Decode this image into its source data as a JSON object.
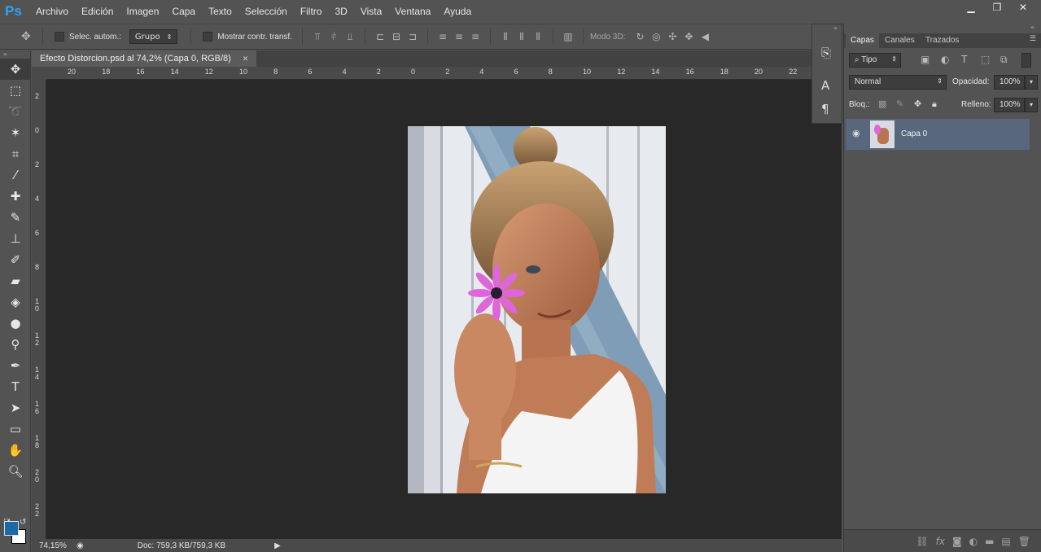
{
  "app": {
    "logo": "Ps"
  },
  "menu": [
    "Archivo",
    "Edición",
    "Imagen",
    "Capa",
    "Texto",
    "Selección",
    "Filtro",
    "3D",
    "Vista",
    "Ventana",
    "Ayuda"
  ],
  "window_controls": {
    "minimize": "▁",
    "restore": "❐",
    "close": "✕"
  },
  "options_bar": {
    "auto_select_label": "Selec. autom.:",
    "auto_select_value": "Grupo",
    "show_transform_label": "Mostrar contr. transf.",
    "mode_3d_label": "Modo 3D:"
  },
  "document": {
    "tab_title": "Efecto Distorcion.psd al 74,2% (Capa 0, RGB/8)",
    "close_glyph": "✕"
  },
  "rulers": {
    "horizontal": [
      "20",
      "18",
      "16",
      "14",
      "12",
      "10",
      "8",
      "6",
      "4",
      "2",
      "0",
      "2",
      "4",
      "6",
      "8",
      "10",
      "12",
      "14",
      "16",
      "18",
      "20",
      "22"
    ],
    "vertical": [
      "2",
      "0",
      "2",
      "4",
      "6",
      "8",
      "1 0",
      "1 2",
      "1 4",
      "1 6",
      "1 8",
      "2 0",
      "2 2"
    ]
  },
  "status": {
    "zoom": "74,15%",
    "doc_info": "Doc: 759,3 KB/759,3 KB"
  },
  "layers_panel": {
    "tabs": [
      "Capas",
      "Canales",
      "Trazados"
    ],
    "filter_label": "Tipo",
    "blend_mode": "Normal",
    "opacity_label": "Opacidad:",
    "opacity_value": "100%",
    "lock_label": "Bloq.:",
    "fill_label": "Relleno:",
    "fill_value": "100%",
    "layers": [
      {
        "name": "Capa 0"
      }
    ]
  },
  "colors": {
    "accent": "#2fa3f7",
    "selected_layer": "#58677e",
    "foreground_swatch": "#1b6aa8",
    "background_swatch": "#ffffff"
  }
}
